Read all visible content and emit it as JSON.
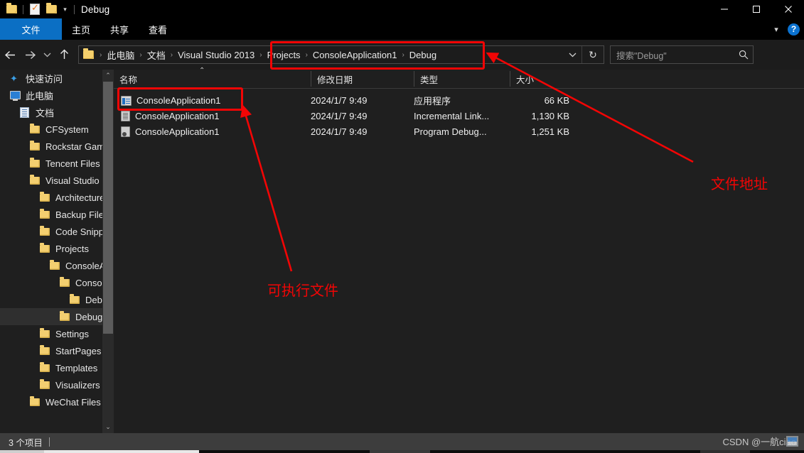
{
  "window": {
    "title": "Debug",
    "quick_access": [
      "folder-icon",
      "properties-icon",
      "new-folder-icon",
      "customize-qat-dropdown-icon"
    ],
    "controls": {
      "minimize": "—",
      "maximize": "□",
      "close": "✕"
    }
  },
  "ribbon": {
    "tabs": [
      {
        "label": "文件",
        "active": true
      },
      {
        "label": "主页",
        "active": false
      },
      {
        "label": "共享",
        "active": false
      },
      {
        "label": "查看",
        "active": false
      }
    ],
    "collapse_caret": "∨",
    "help_label": "?"
  },
  "address_bar": {
    "back_icon": "←",
    "forward_icon": "→",
    "recent_icon": "∨",
    "up_icon": "↑",
    "breadcrumbs": [
      "此电脑",
      "文档",
      "Visual Studio 2013",
      "Projects",
      "ConsoleApplication1",
      "Debug"
    ],
    "separator": "›",
    "dropdown_icon": "∨",
    "refresh_icon": "↻",
    "search_placeholder": "搜索\"Debug\"",
    "search_value": ""
  },
  "nav_pane": {
    "items": [
      {
        "label": "快速访问",
        "icon": "star-icon",
        "indent": 0,
        "selected": false
      },
      {
        "label": "此电脑",
        "icon": "computer-icon",
        "indent": 0,
        "selected": false
      },
      {
        "label": "文档",
        "icon": "documents-icon",
        "indent": 1,
        "selected": false
      },
      {
        "label": "CFSystem",
        "icon": "folder-icon",
        "indent": 2,
        "selected": false
      },
      {
        "label": "Rockstar Gam",
        "icon": "folder-icon",
        "indent": 2,
        "selected": false
      },
      {
        "label": "Tencent Files",
        "icon": "folder-icon",
        "indent": 2,
        "selected": false
      },
      {
        "label": "Visual Studio",
        "icon": "folder-icon",
        "indent": 2,
        "selected": false
      },
      {
        "label": "Architecture",
        "icon": "folder-icon",
        "indent": 3,
        "selected": false
      },
      {
        "label": "Backup Files",
        "icon": "folder-icon",
        "indent": 3,
        "selected": false
      },
      {
        "label": "Code Snipp",
        "icon": "folder-icon",
        "indent": 3,
        "selected": false
      },
      {
        "label": "Projects",
        "icon": "folder-icon",
        "indent": 3,
        "selected": false
      },
      {
        "label": "ConsoleAp",
        "icon": "folder-icon",
        "indent": 4,
        "selected": false
      },
      {
        "label": "ConsoleA",
        "icon": "folder-icon",
        "indent": 5,
        "selected": false
      },
      {
        "label": "Debug",
        "icon": "folder-icon",
        "indent": 6,
        "selected": false
      },
      {
        "label": "Debug",
        "icon": "folder-icon",
        "indent": 5,
        "selected": true
      },
      {
        "label": "Settings",
        "icon": "folder-icon",
        "indent": 3,
        "selected": false
      },
      {
        "label": "StartPages",
        "icon": "folder-icon",
        "indent": 3,
        "selected": false
      },
      {
        "label": "Templates",
        "icon": "folder-icon",
        "indent": 3,
        "selected": false
      },
      {
        "label": "Visualizers",
        "icon": "folder-icon",
        "indent": 3,
        "selected": false
      },
      {
        "label": "WeChat Files",
        "icon": "folder-icon",
        "indent": 2,
        "selected": false
      }
    ],
    "scroll_up_icon": "⌃",
    "scroll_down_icon": "⌄"
  },
  "file_list": {
    "columns": [
      "名称",
      "修改日期",
      "类型",
      "大小"
    ],
    "sort_indicator": "⌃",
    "rows": [
      {
        "name": "ConsoleApplication1",
        "date": "2024/1/7 9:49",
        "type": "应用程序",
        "size": "66 KB",
        "icon": "application-exe-icon"
      },
      {
        "name": "ConsoleApplication1",
        "date": "2024/1/7 9:49",
        "type": "Incremental Link...",
        "size": "1,130 KB",
        "icon": "incremental-link-file-icon"
      },
      {
        "name": "ConsoleApplication1",
        "date": "2024/1/7 9:49",
        "type": "Program Debug...",
        "size": "1,251 KB",
        "icon": "program-debug-database-icon"
      }
    ]
  },
  "status_bar": {
    "item_count": "3 个项目",
    "watermark": "CSDN @一航ciao"
  },
  "annotations": {
    "color": "#f20505",
    "labels": [
      {
        "text": "文件地址",
        "target": "address-bar-breadcrumbs"
      },
      {
        "text": "可执行文件",
        "target": "executable-file-row"
      }
    ]
  }
}
